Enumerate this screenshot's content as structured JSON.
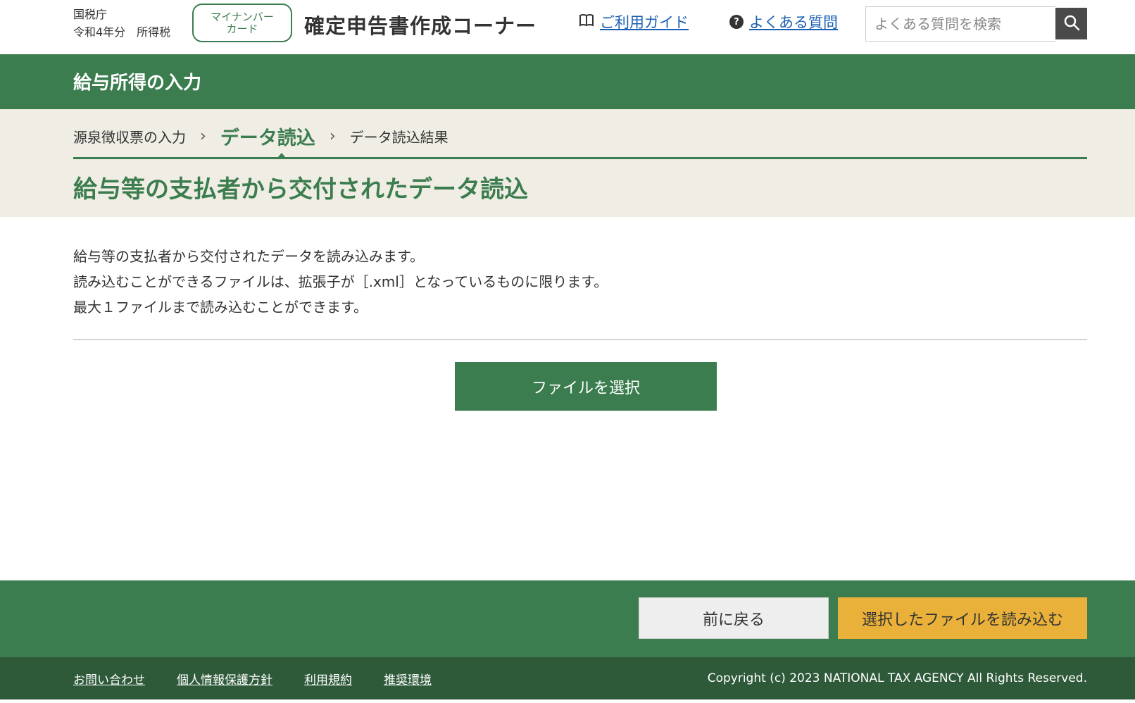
{
  "header": {
    "agency": "国税庁",
    "year_tax": "令和4年分　所得税",
    "mynumber_line1": "マイナンバー",
    "mynumber_line2": "カード",
    "site_title": "確定申告書作成コーナー",
    "guide_label": "ご利用ガイド",
    "faq_label": "よくある質問",
    "search_placeholder": "よくある質問を検索"
  },
  "section": {
    "title": "給与所得の入力"
  },
  "steps": [
    {
      "label": "源泉徴収票の入力"
    },
    {
      "label": "データ読込"
    },
    {
      "label": "データ読込結果"
    }
  ],
  "page": {
    "title": "給与等の支払者から交付されたデータ読込",
    "description": [
      "給与等の支払者から交付されたデータを読み込みます。",
      "読み込むことができるファイルは、拡張子が［.xml］となっているものに限ります。",
      "最大１ファイルまで読み込むことができます。"
    ],
    "select_file_label": "ファイルを選択"
  },
  "actions": {
    "back_label": "前に戻る",
    "load_label": "選択したファイルを読み込む"
  },
  "footer": {
    "links": [
      "お問い合わせ",
      "個人情報保護方針",
      "利用規約",
      "推奨環境"
    ],
    "copyright": "Copyright (c) 2023 NATIONAL TAX AGENCY All Rights Reserved."
  },
  "colors": {
    "brand_green": "#3b7d4e",
    "footer_green": "#2e5a3a",
    "accent_yellow": "#e9b13a",
    "beige": "#f0ede5",
    "link_blue": "#1a5fb4"
  },
  "icons": {
    "guide": "book-icon",
    "faq": "question-icon",
    "search": "search-icon",
    "step_separator": "chevron-right-icon"
  }
}
